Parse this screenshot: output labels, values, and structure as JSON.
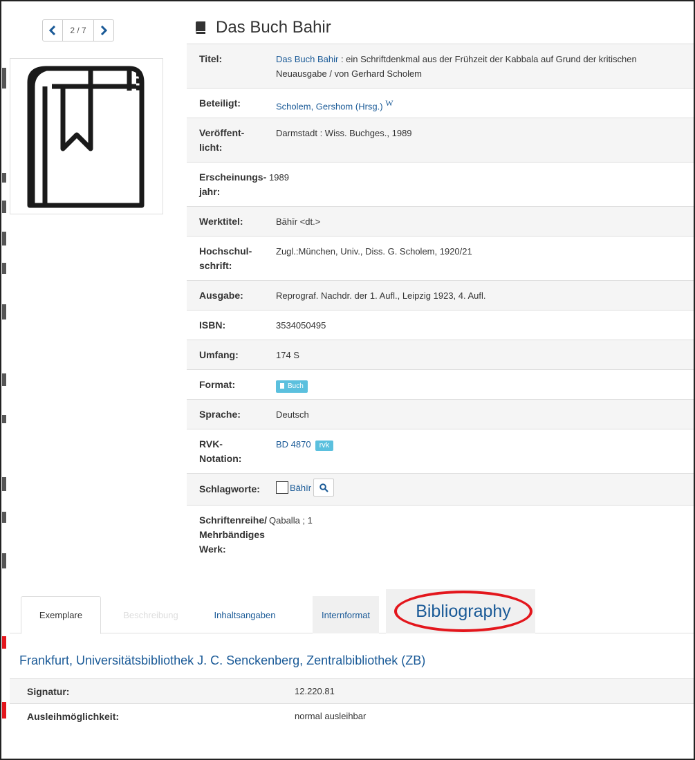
{
  "pager": {
    "counter": "2 / 7"
  },
  "record": {
    "title": "Das Buch Bahir"
  },
  "details": {
    "titel_label": "Titel:",
    "titel_link": "Das Buch Bahir",
    "titel_rest": " : ein Schriftdenkmal aus der Frühzeit der Kabbala auf Grund der kritischen Neuausgabe / von Gerhard Scholem",
    "beteiligt_label": "Beteiligt:",
    "beteiligt_value": "Scholem, Gershom (Hrsg.)",
    "beteiligt_wiki": "W",
    "veroeffentlicht_label_1": "Veröffent-",
    "veroeffentlicht_label_2": "licht:",
    "veroeffentlicht_value": "Darmstadt : Wiss. Buchges., 1989",
    "erscheinungsjahr_label_1": "Erscheinungs-",
    "erscheinungsjahr_label_2": "jahr:",
    "erscheinungsjahr_value": "1989",
    "werktitel_label": "Werktitel:",
    "werktitel_value": "Bāhīr <dt.>",
    "hochschulschrift_label_1": "Hochschul-",
    "hochschulschrift_label_2": "schrift:",
    "hochschulschrift_value": "Zugl.:München, Univ., Diss. G. Scholem, 1920/21",
    "ausgabe_label": "Ausgabe:",
    "ausgabe_value": "Reprograf. Nachdr. der 1. Aufl., Leipzig 1923, 4. Aufl.",
    "isbn_label": "ISBN:",
    "isbn_value": "3534050495",
    "umfang_label": "Umfang:",
    "umfang_value": "174 S",
    "format_label": "Format:",
    "format_value": "Buch",
    "sprache_label": "Sprache:",
    "sprache_value": "Deutsch",
    "rvk_label_1": "RVK-",
    "rvk_label_2": "Notation:",
    "rvk_value": "BD 4870",
    "rvk_badge": "rvk",
    "schlagworte_label": "Schlagworte:",
    "schlagworte_value": "Bāhīr",
    "schriftenreihe_label_1": "Schriftenreihe/",
    "schriftenreihe_label_2": "Mehrbändiges",
    "schriftenreihe_label_3": "Werk:",
    "schriftenreihe_value": "Qaballa ; 1"
  },
  "tabs": {
    "exemplare": "Exemplare",
    "beschreibung": "Beschreibung",
    "inhaltsangaben": "Inhaltsangaben",
    "internformat": "Internformat",
    "bibliography": "Bibliography"
  },
  "holdings": {
    "library": "Frankfurt, Universitätsbibliothek J. C. Senckenberg, Zentralbibliothek (ZB)",
    "signatur_label": "Signatur:",
    "signatur_value": "12.220.81",
    "ausleih_label": "Ausleihmöglichkeit:",
    "ausleih_value": "normal ausleihbar"
  },
  "colors": {
    "link": "#1a5a97",
    "badge": "#5bc0de",
    "highlight_ellipse": "#e3161c",
    "row_shade": "#f5f5f5"
  },
  "icons": {
    "prev": "chevron-left-icon",
    "next": "chevron-right-icon",
    "title": "book-icon",
    "cover": "book-cover-icon",
    "search": "search-icon"
  }
}
